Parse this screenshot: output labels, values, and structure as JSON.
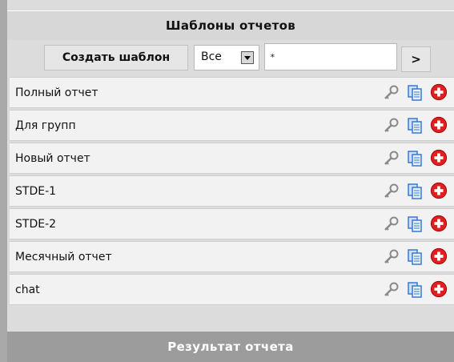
{
  "header": {
    "title": "Шаблоны отчетов"
  },
  "toolbar": {
    "create_label": "Создать шаблон",
    "select_value": "Все",
    "filter_value": "*",
    "go_label": ">"
  },
  "templates": [
    {
      "label": "Полный отчет"
    },
    {
      "label": "Для групп"
    },
    {
      "label": "Новый отчет"
    },
    {
      "label": "STDE-1"
    },
    {
      "label": "STDE-2"
    },
    {
      "label": "Месячный отчет"
    },
    {
      "label": "chat"
    }
  ],
  "row_icons": [
    "key-icon",
    "copy-icon",
    "delete-icon"
  ],
  "footer": {
    "result_label": "Результат отчета"
  },
  "colors": {
    "delete_red": "#e02020",
    "copy_blue": "#3a78d0",
    "header_bg": "#d7d7d7",
    "result_bar_bg": "#9c9c9c"
  }
}
